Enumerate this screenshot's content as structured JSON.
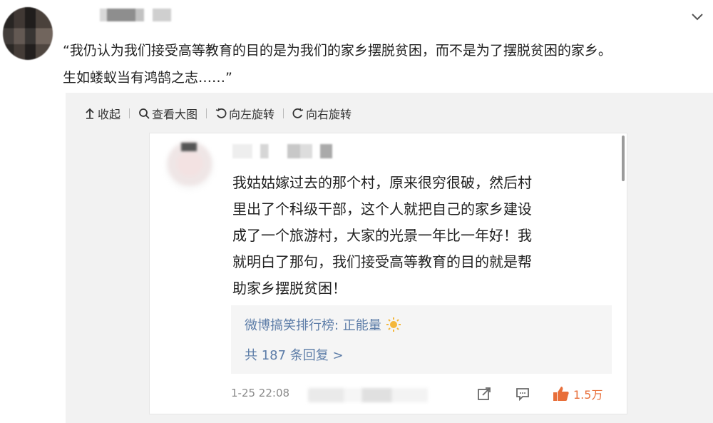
{
  "post": {
    "text_lines": [
      "“我仍认为我们接受高等教育的目的是为我们的家乡摆脱贫困，而不是为了摆脱贫困的家乡。",
      "生如蝼蚁当有鸿鹄之志……”"
    ]
  },
  "toolbar": {
    "collapse": "收起",
    "view_large": "查看大图",
    "rotate_left": "向左旋转",
    "rotate_right": "向右旋转"
  },
  "card": {
    "text_lines": [
      "我姑姑嫁过去的那个村，原来很穷很破，然后村",
      "里出了个科级干部，这个人就把自己的家乡建设",
      "成了一个旅游村，大家的光景一年比一年好！我",
      "就明白了那句，我们接受高等教育的目的就是帮",
      "助家乡摆脱贫困！"
    ],
    "source": "微博搞笑排行榜: 正能量",
    "replies": "共 187 条回复 >",
    "time": "1-25 22:08",
    "likes": "1.5万"
  },
  "icons": {
    "chevron": "chevron-down-icon",
    "collapse": "arrow-up-icon",
    "view_large": "magnifier-icon",
    "rotate_left": "rotate-left-icon",
    "rotate_right": "rotate-right-icon",
    "sun": "sun-emoji-icon",
    "share": "share-icon",
    "comment": "comment-icon",
    "like": "thumbs-up-icon"
  },
  "colors": {
    "link": "#5d7da8",
    "like": "#e86f3a"
  }
}
